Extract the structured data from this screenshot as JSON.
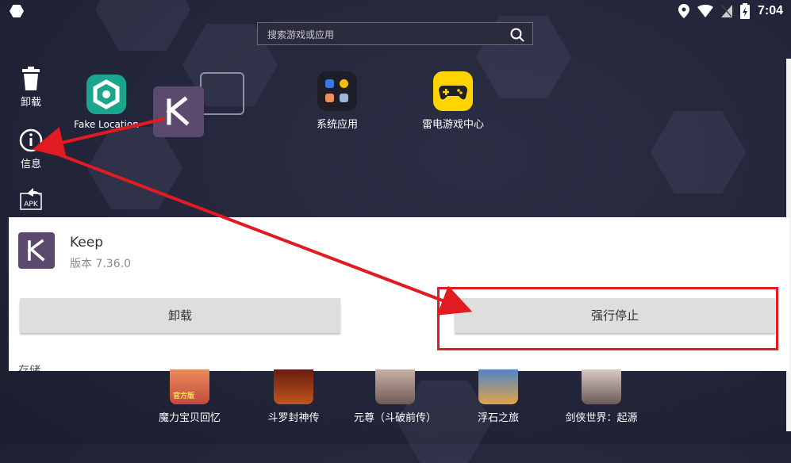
{
  "statusbar": {
    "time": "7:04",
    "icons": [
      "home-hex-icon",
      "location-icon",
      "wifi-icon",
      "no-sim-icon",
      "battery-charging-icon"
    ]
  },
  "search": {
    "placeholder": "搜索游戏或应用",
    "icon": "search-icon"
  },
  "sidebar": {
    "items": [
      {
        "label": "卸载",
        "icon": "trash-icon"
      },
      {
        "label": "信息",
        "icon": "info-icon"
      },
      {
        "label": "APK",
        "icon": "apk-share-icon"
      }
    ]
  },
  "desktop": {
    "apps": [
      {
        "label": "Fake Location",
        "icon": "fake-location-icon"
      },
      {
        "label": "系统应用",
        "icon": "system-apps-folder-icon"
      },
      {
        "label": "雷电游戏中心",
        "icon": "game-center-icon"
      }
    ]
  },
  "dialog": {
    "app_name": "Keep",
    "version": "版本 7.36.0",
    "uninstall_label": "卸载",
    "force_stop_label": "强行停止",
    "storage_label": "存储"
  },
  "games": [
    {
      "label": "魔力宝贝回忆",
      "badge": "官方版"
    },
    {
      "label": "斗罗封神传"
    },
    {
      "label": "元尊（斗破前传）"
    },
    {
      "label": "浮石之旅"
    },
    {
      "label": "剑侠世界：起源"
    }
  ],
  "colors": {
    "annotation_red": "#e21b22",
    "keep_purple": "#5b4a6e",
    "background": "#23253a"
  }
}
